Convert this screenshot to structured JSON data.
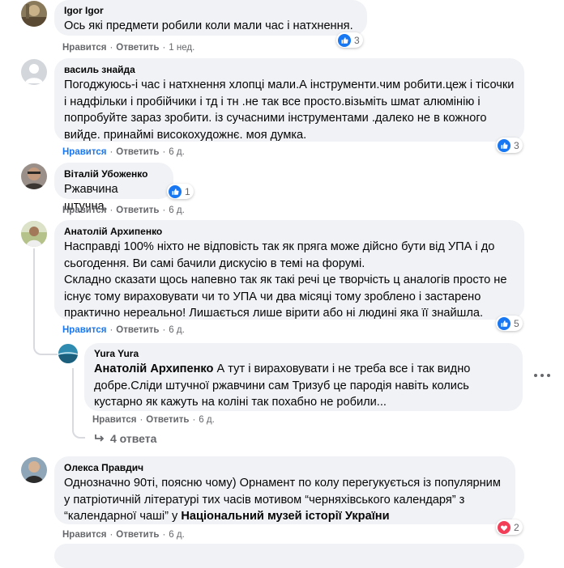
{
  "comments": [
    {
      "author": "Igor Igor",
      "text": "Ось які предмети робили коли мали час і натхнення.",
      "reaction_count": "3",
      "like_label": "Нравится",
      "reply_label": "Ответить",
      "time": "1 нед."
    },
    {
      "author": "василь знайда",
      "text": "Погоджуюсь-і час і натхнення хлопці мали.А інструменти.чим робити.цеж і тісочки і надфільки і пробійчики і тд і тн .не так все просто.візьміть шмат алюмінію і попробуйте зараз зробити. із сучасними інструментами .далеко не в кожного вийде. принаймі високохудожнє. моя думка.",
      "reaction_count": "3",
      "like_label": "Нравится",
      "reply_label": "Ответить",
      "time": "6 д."
    },
    {
      "author": "Віталій Убоженко",
      "text": "Ржавчина штучна.",
      "reaction_count": "1",
      "like_label": "Нравится",
      "reply_label": "Ответить",
      "time": "6 д."
    },
    {
      "author": "Анатолій Архипенко",
      "text": "Насправді 100% ніхто не відповість так як пряга може дійсно бути від УПА і до сьогодення. Ви самі бачили дискусію в темі на форумі.",
      "text2": "Складно сказати щось напевно так як такі речі це творчість ц аналогів просто не існує тому вираховувати чи то УПА чи два місяці тому зроблено і застарено практично нереально! Лишається лише вірити або ні людині яка її знайшла.",
      "reaction_count": "5",
      "like_label": "Нравится",
      "reply_label": "Ответить",
      "time": "6 д."
    },
    {
      "author": "Oлекса Правдич",
      "text": "Однозначно 90ті, поясню чому) Орнамент по колу перегукується із популярним у патріотичній літературі тих часів мотивом “черняхівського календаря” з “календарної чаші” у",
      "tag": "Національний музей історії України",
      "reaction_count": "2",
      "like_label": "Нравится",
      "reply_label": "Ответить",
      "time": "6 д."
    }
  ],
  "reply": {
    "author": "Yura Yura",
    "mention": "Анатолій Архипенко",
    "text": "А тут і вираховувати і не треба все і так видно добре.Сліди штучної ржавчини сам Тризуб це пародія навіть колись кустарно як кажуть на коліні так похабно не робили...",
    "like_label": "Нравится",
    "reply_label": "Ответить",
    "time": "6 д."
  },
  "more_replies_label": "4 ответа",
  "colors": {
    "like_blue": "#1877f2",
    "love_red": "#f33e58",
    "bubble": "#f0f2f5",
    "meta_gray": "#65676b"
  },
  "icons": [
    "like-icon",
    "love-icon",
    "more-options-icon",
    "reply-arrow-icon"
  ]
}
